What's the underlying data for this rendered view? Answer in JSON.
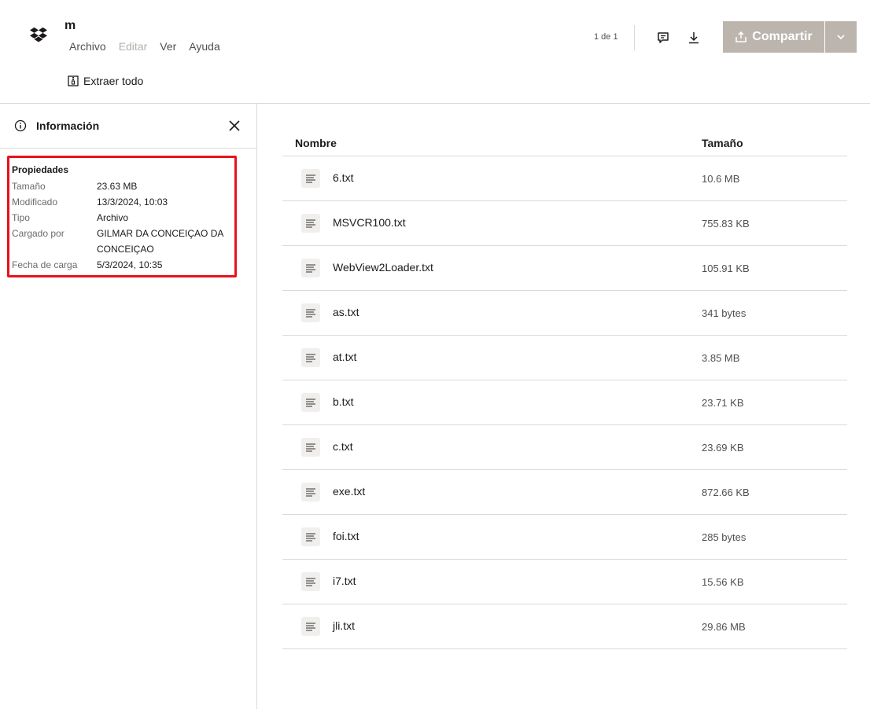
{
  "header": {
    "file_title": "m",
    "menu": [
      "Archivo",
      "Editar",
      "Ver",
      "Ayuda"
    ],
    "extract_label": "Extraer todo",
    "pager": "1 de 1",
    "share_label": "Compartir"
  },
  "sidebar": {
    "title": "Información",
    "properties_title": "Propiedades",
    "properties": [
      {
        "label": "Tamaño",
        "value": "23.63 MB"
      },
      {
        "label": "Modificado",
        "value": "13/3/2024, 10:03"
      },
      {
        "label": "Tipo",
        "value": "Archivo"
      },
      {
        "label": "Cargado por",
        "value": "GILMAR DA CONCEIÇAO DA CONCEIÇAO"
      },
      {
        "label": "Fecha de carga",
        "value": "5/3/2024, 10:35"
      }
    ]
  },
  "list": {
    "col_name": "Nombre",
    "col_size": "Tamaño",
    "files": [
      {
        "name": "6.txt",
        "size": "10.6 MB"
      },
      {
        "name": "MSVCR100.txt",
        "size": "755.83 KB"
      },
      {
        "name": "WebView2Loader.txt",
        "size": "105.91 KB"
      },
      {
        "name": "as.txt",
        "size": "341 bytes"
      },
      {
        "name": "at.txt",
        "size": "3.85 MB"
      },
      {
        "name": "b.txt",
        "size": "23.71 KB"
      },
      {
        "name": "c.txt",
        "size": "23.69 KB"
      },
      {
        "name": "exe.txt",
        "size": "872.66 KB"
      },
      {
        "name": "foi.txt",
        "size": "285 bytes"
      },
      {
        "name": "i7.txt",
        "size": "15.56 KB"
      },
      {
        "name": "jli.txt",
        "size": "29.86 MB"
      }
    ]
  },
  "icons": {
    "logo": "dropbox-logo-icon",
    "extract": "archive-icon",
    "comment": "comment-icon",
    "download": "download-icon",
    "share": "share-upload-icon",
    "chevron": "chevron-down-icon",
    "info": "info-icon",
    "close": "close-icon",
    "file": "text-file-icon"
  },
  "colors": {
    "share_button": "#bbb5ae",
    "highlight_border": "#e8121b",
    "divider": "#dcd9d5"
  }
}
